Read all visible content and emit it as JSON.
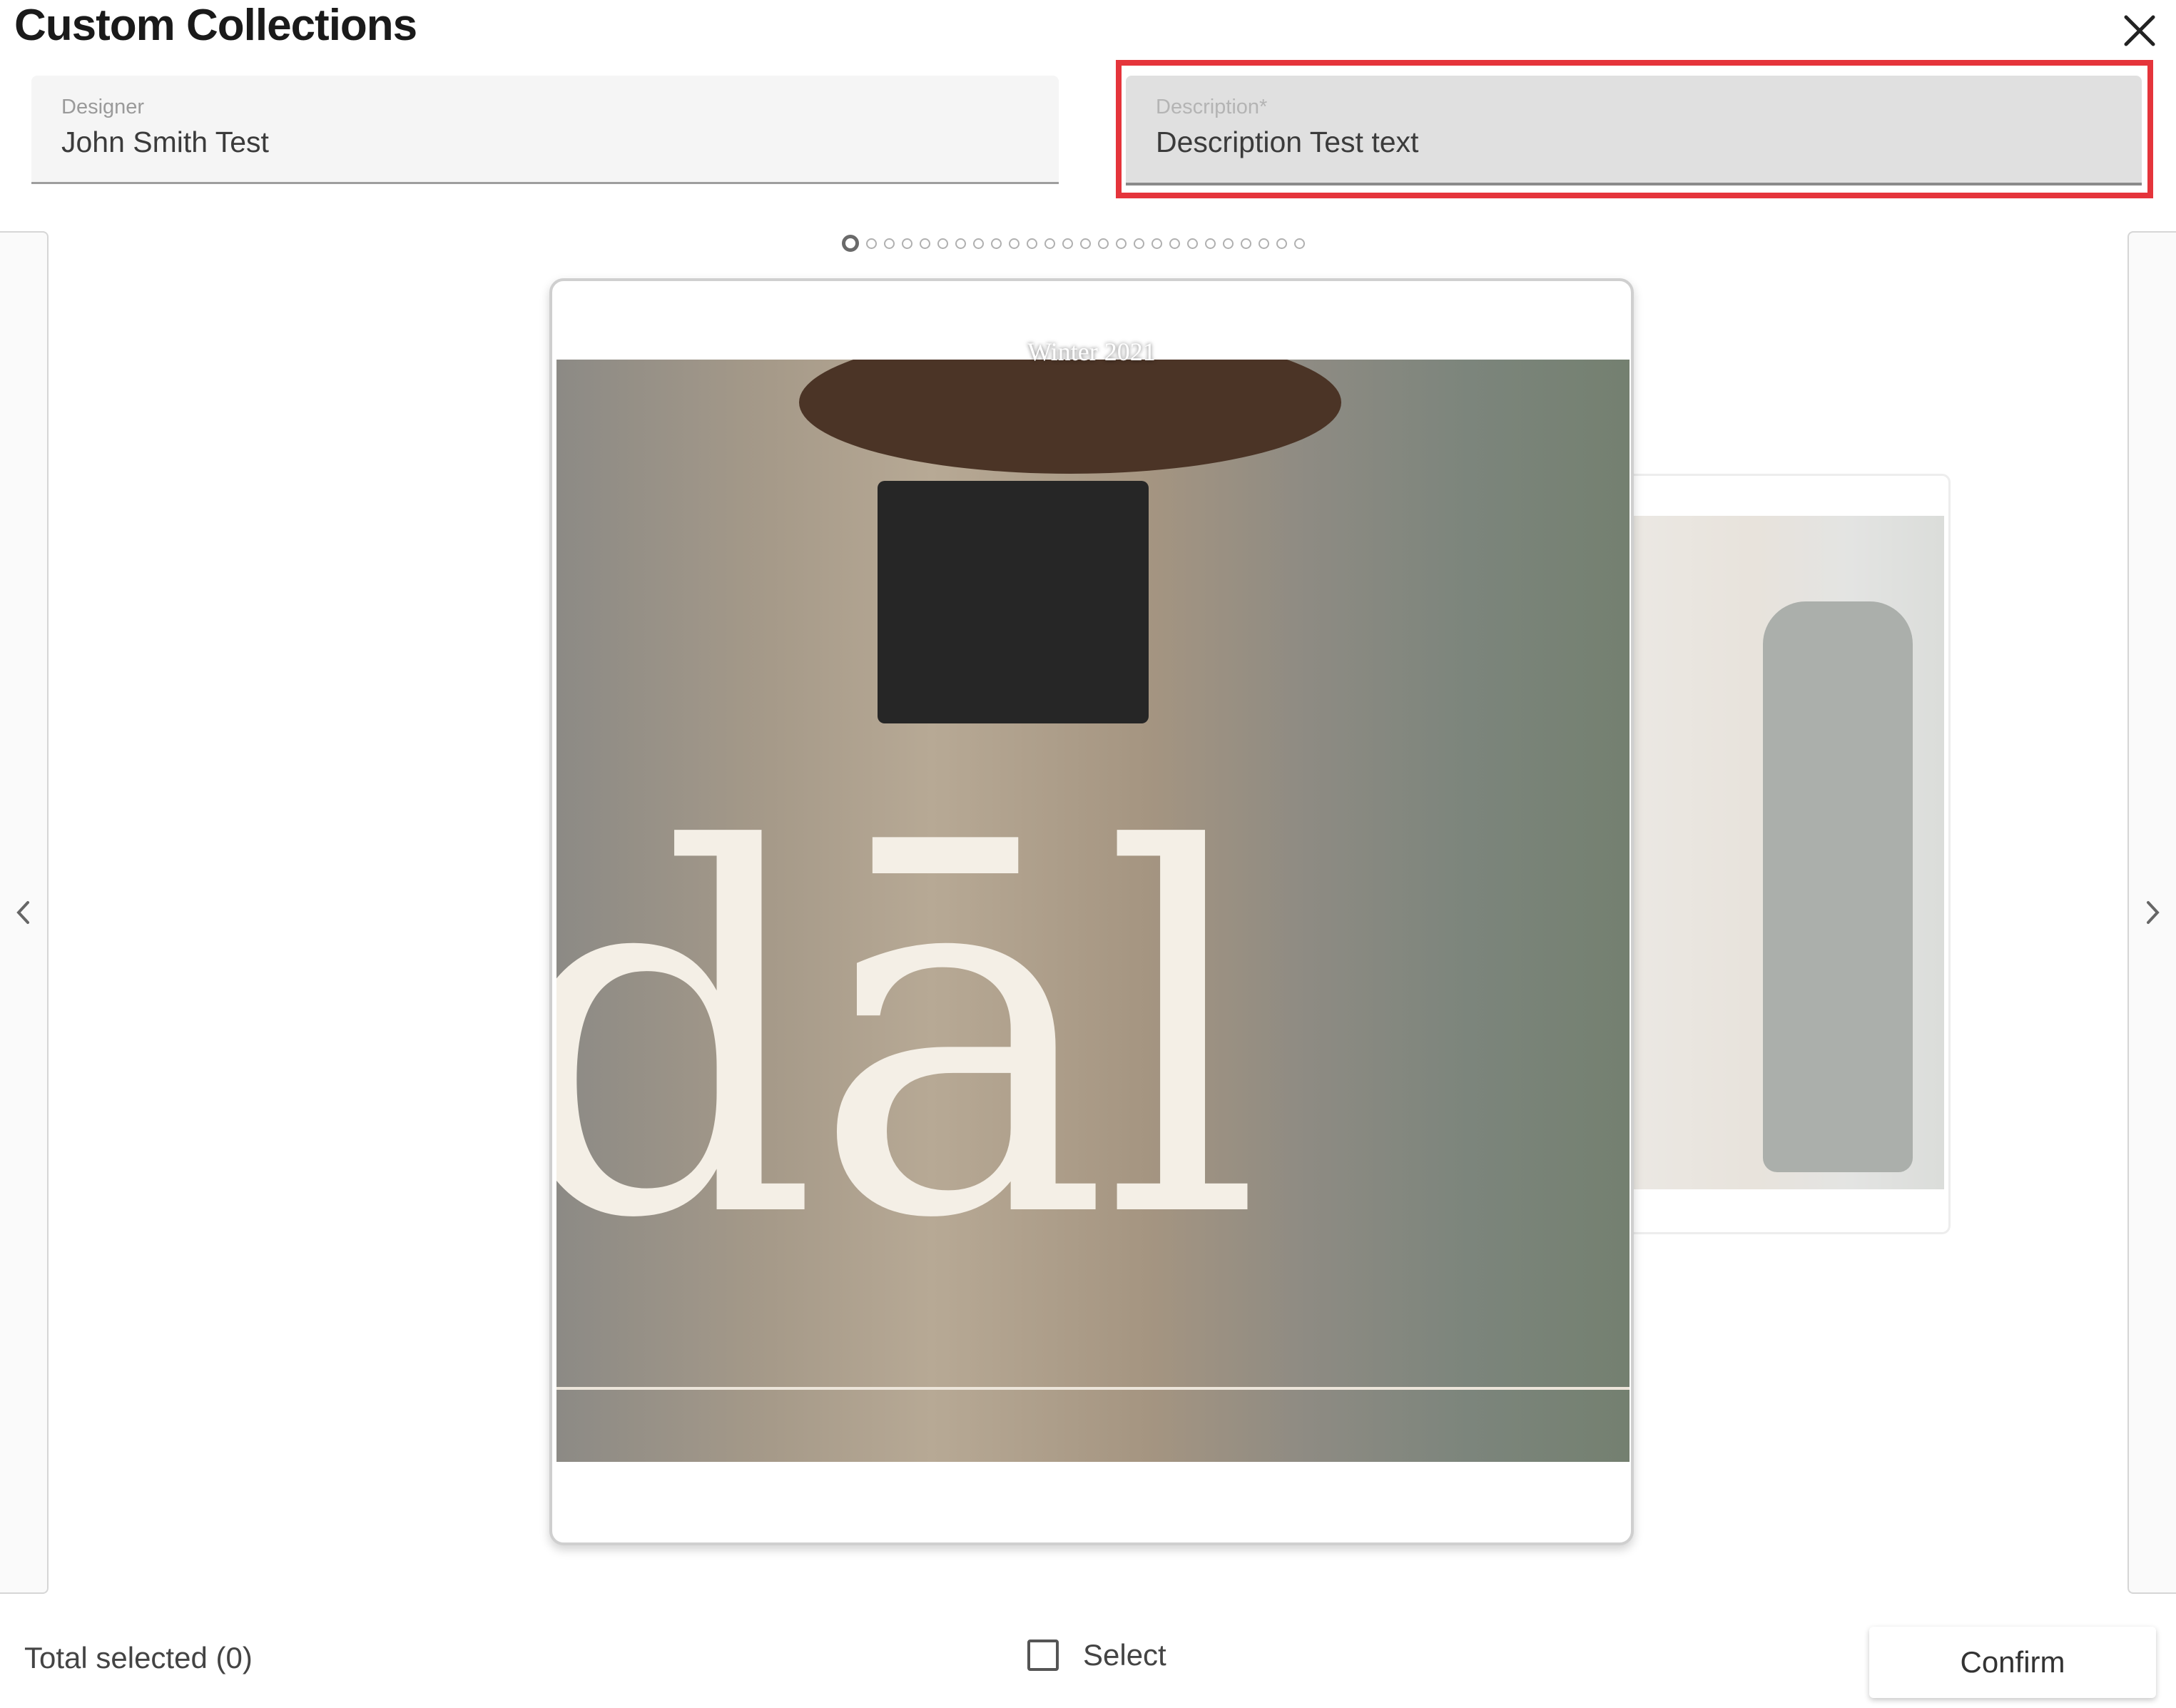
{
  "dialog": {
    "title": "Custom Collections",
    "close_icon": "close-icon"
  },
  "designer": {
    "label": "Designer",
    "value": "John Smith Test"
  },
  "description": {
    "label": "Description*",
    "value": "Description Test text",
    "highlighted": true,
    "highlight_color": "#e5343b"
  },
  "carousel": {
    "total_pages": 26,
    "current_page": 1,
    "current_card": {
      "caption": "Winter 2021",
      "image_text": "dāl"
    },
    "prev_icon": "chevron-left-icon",
    "next_icon": "chevron-right-icon"
  },
  "footer": {
    "total_selected": "Total selected (0)",
    "select_label": "Select",
    "select_checked": false,
    "confirm_label": "Confirm"
  }
}
